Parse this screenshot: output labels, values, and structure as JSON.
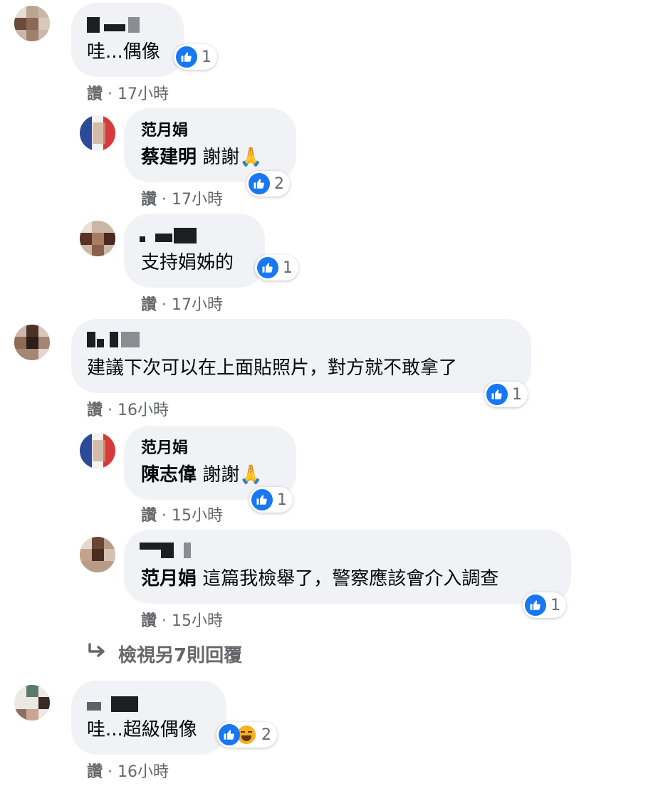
{
  "comments": [
    {
      "id": "c1",
      "text": "哇...偶像",
      "reaction_count": "1",
      "like_label": "讚",
      "sep": "·",
      "time": "17小時",
      "replies": [
        {
          "id": "r1",
          "author": "范月娟",
          "mention": "蔡建明",
          "text": " 謝謝🙏",
          "reaction_count": "2",
          "like_label": "讚",
          "sep": "·",
          "time": "17小時"
        },
        {
          "id": "r2",
          "text": "支持娟姊的",
          "reaction_count": "1",
          "like_label": "讚",
          "sep": "·",
          "time": "17小時"
        }
      ]
    },
    {
      "id": "c2",
      "text": "建議下次可以在上面貼照片，對方就不敢拿了",
      "reaction_count": "1",
      "like_label": "讚",
      "sep": "·",
      "time": "16小時",
      "replies": [
        {
          "id": "r3",
          "author": "范月娟",
          "mention": "陳志偉",
          "text": " 謝謝🙏",
          "reaction_count": "1",
          "like_label": "讚",
          "sep": "·",
          "time": "15小時"
        },
        {
          "id": "r4",
          "mention": "范月娟",
          "text": " 這篇我檢舉了，警察應該會介入調查",
          "reaction_count": "1",
          "like_label": "讚",
          "sep": "·",
          "time": "15小時"
        }
      ],
      "more_replies": "檢視另7則回覆"
    },
    {
      "id": "c3",
      "text": "哇...超級偶像",
      "reaction_count": "2",
      "like_label": "讚",
      "sep": "·",
      "time": "16小時"
    }
  ],
  "icons": {
    "like": "thumbs-up-icon",
    "haha": "haha-icon",
    "reply_arrow": "reply-arrow-icon"
  },
  "colors": {
    "like_blue": "#1877f2",
    "bubble": "#f0f2f5",
    "meta_gray": "#65676b"
  }
}
